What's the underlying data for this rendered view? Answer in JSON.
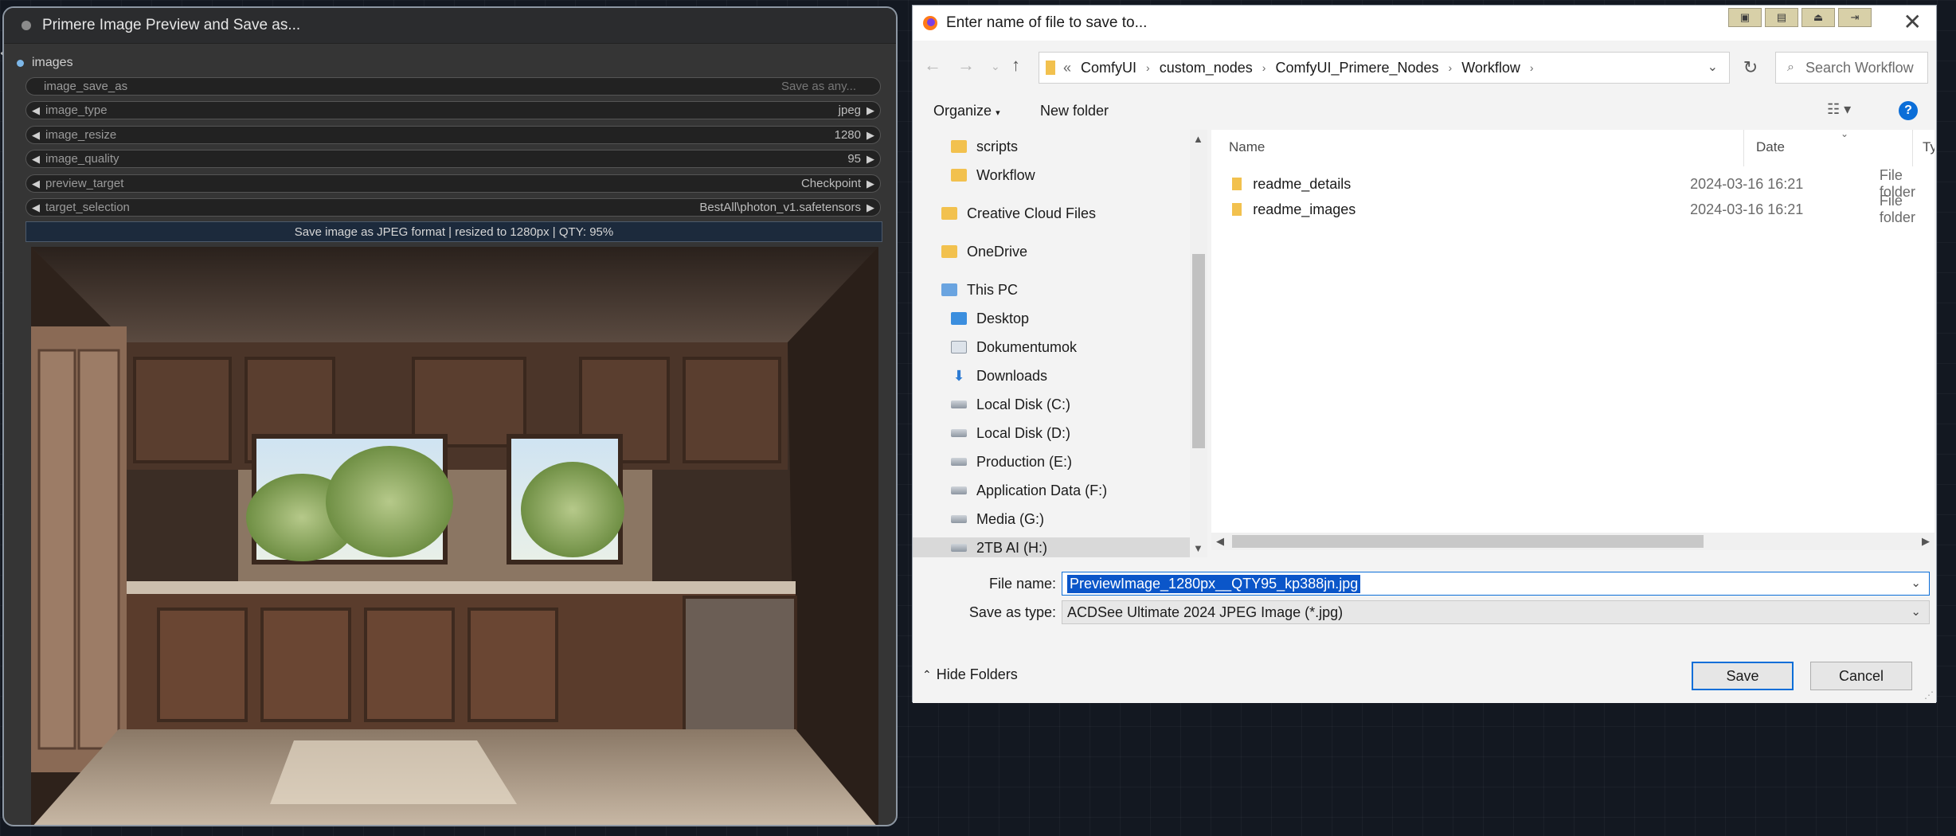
{
  "node": {
    "title": "Primere Image Preview and Save as...",
    "input_label": "images",
    "widgets": [
      {
        "label": "image_save_as",
        "value": "Save as any..."
      },
      {
        "label": "image_type",
        "value": "jpeg"
      },
      {
        "label": "image_resize",
        "value": "1280"
      },
      {
        "label": "image_quality",
        "value": "95"
      },
      {
        "label": "preview_target",
        "value": "Checkpoint"
      },
      {
        "label": "target_selection",
        "value": "BestAll\\photon_v1.safetensors"
      }
    ],
    "status": "Save image as JPEG format |  resized to 1280px | QTY: 95%"
  },
  "dialog": {
    "title": "Enter name of file to save to...",
    "breadcrumb": [
      "«",
      "ComfyUI",
      "custom_nodes",
      "ComfyUI_Primere_Nodes",
      "Workflow"
    ],
    "search_placeholder": "Search Workflow",
    "organize": "Organize",
    "new_folder": "New folder",
    "nav_items": [
      {
        "label": "scripts",
        "icon": "folder-icon"
      },
      {
        "label": "Workflow",
        "icon": "folder-icon"
      },
      {
        "label": "Creative Cloud Files",
        "icon": "folder-icon"
      },
      {
        "label": "OneDrive",
        "icon": "folder-icon"
      },
      {
        "label": "This PC",
        "icon": "pc-icon"
      },
      {
        "label": "Desktop",
        "icon": "desktop-icon"
      },
      {
        "label": "Dokumentumok",
        "icon": "document-icon"
      },
      {
        "label": "Downloads",
        "icon": "download-icon"
      },
      {
        "label": "Local Disk (C:)",
        "icon": "drive-icon"
      },
      {
        "label": "Local Disk (D:)",
        "icon": "drive-icon"
      },
      {
        "label": "Production (E:)",
        "icon": "drive-icon"
      },
      {
        "label": "Application Data (F:)",
        "icon": "drive-icon"
      },
      {
        "label": "Media (G:)",
        "icon": "drive-icon"
      },
      {
        "label": "2TB AI (H:)",
        "icon": "drive-icon"
      }
    ],
    "columns": [
      "Name",
      "Date",
      "Type"
    ],
    "files": [
      {
        "name": "readme_details",
        "date": "2024-03-16 16:21",
        "type": "File folder"
      },
      {
        "name": "readme_images",
        "date": "2024-03-16 16:21",
        "type": "File folder"
      }
    ],
    "file_name_label": "File name:",
    "file_name_value": "PreviewImage_1280px__QTY95_kp388jn.jpg",
    "save_type_label": "Save as type:",
    "save_type_value": "ACDSee Ultimate 2024 JPEG Image (*.jpg)",
    "hide_folders": "Hide Folders",
    "save": "Save",
    "cancel": "Cancel"
  },
  "colors": {
    "accent": "#0b6ed8",
    "node_bg": "#353535",
    "canvas_bg": "#131821"
  }
}
